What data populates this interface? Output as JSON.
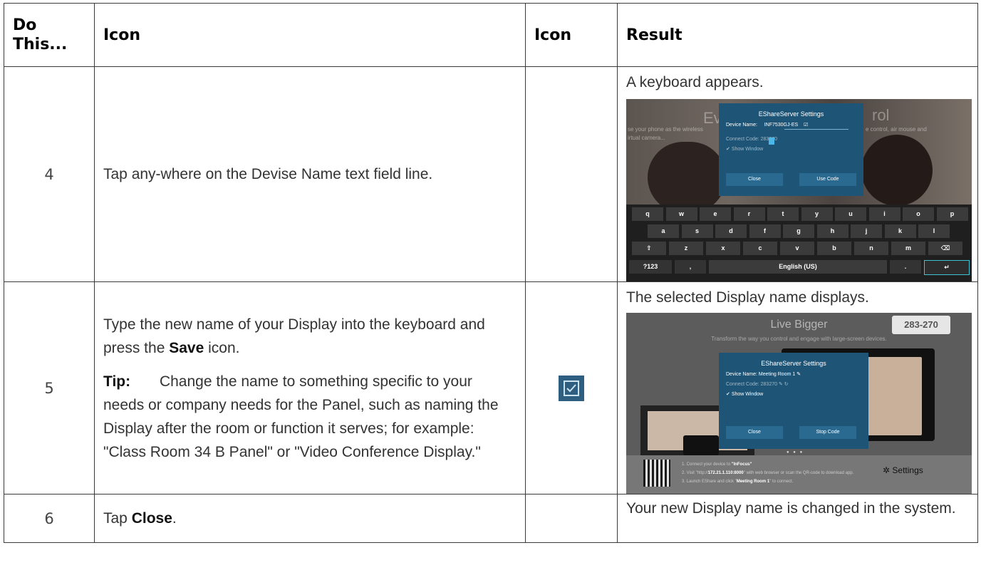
{
  "headers": [
    "Do This...",
    "Icon",
    "Icon",
    "Result"
  ],
  "rows": [
    {
      "step": "4",
      "instruction": "Tap any-where on the Devise Name text field line.",
      "result": "A keyboard appears."
    },
    {
      "step": "5",
      "instruction_pre": "Type the new name of your Display into the keyboard and press the ",
      "instruction_bold": "Save",
      "instruction_post": " icon.",
      "tip_label": "Tip:",
      "tip_text": "Change the name to something specific to your needs or company needs for the Panel, such as naming the Display after the room or function it serves; for example: \"Class Room 34 B Panel\" or \"Video Conference Display.\"",
      "icon": "save-checkbox-icon",
      "result": "The selected Display name displays."
    },
    {
      "step": "6",
      "instruction_pre": "Tap ",
      "instruction_bold": "Close",
      "instruction_post": ".",
      "result": "Your new Display name is changed in the system."
    }
  ],
  "shot1": {
    "bg_left": "Ev",
    "bg_right": "rol",
    "bg_sub_left": "se your phone as the wireless",
    "bg_sub_left2": "irtual camera...",
    "bg_sub_right": "e control, air mouse and",
    "dialog_title": "EShareServer Settings",
    "device_label": "Device Name:",
    "device_value": "INF7530GJ-ES",
    "connect_code": "Connect Code: 283270",
    "show_window": "Show Window",
    "close": "Close",
    "use_code": "Use Code",
    "row1": [
      "q",
      "w",
      "e",
      "r",
      "t",
      "y",
      "u",
      "i",
      "o",
      "p"
    ],
    "row2": [
      "a",
      "s",
      "d",
      "f",
      "g",
      "h",
      "j",
      "k",
      "l"
    ],
    "row3": [
      "⇧",
      "z",
      "x",
      "c",
      "v",
      "b",
      "n",
      "m",
      "⌫"
    ],
    "row4": [
      "?123",
      ",",
      "English (US)",
      ".",
      "↵"
    ]
  },
  "shot2": {
    "title": "Live Bigger",
    "subtitle": "Transform the way you control and engage with large-screen devices.",
    "code": "283-270",
    "dialog_title": "EShareServer Settings",
    "device_line": "Device Name: Meeting  Room 1",
    "connect_code": "Connect Code: 283270",
    "show_window": "Show Window",
    "close": "Close",
    "stop_code": "Stop Code",
    "instr1_pre": "1. Connect your device to ",
    "instr1_bold": "\"InFocus\"",
    "instr2_pre": "2. Visit \"http://",
    "instr2_bold": "172.21.1.110:8000",
    "instr2_post": "\" with web browser or scan the QR-code to download app.",
    "instr3_pre": "3. Launch EShare and click \"",
    "instr3_bold": "Meeting Room 1",
    "instr3_post": "\" to connect.",
    "settings": "Settings"
  }
}
